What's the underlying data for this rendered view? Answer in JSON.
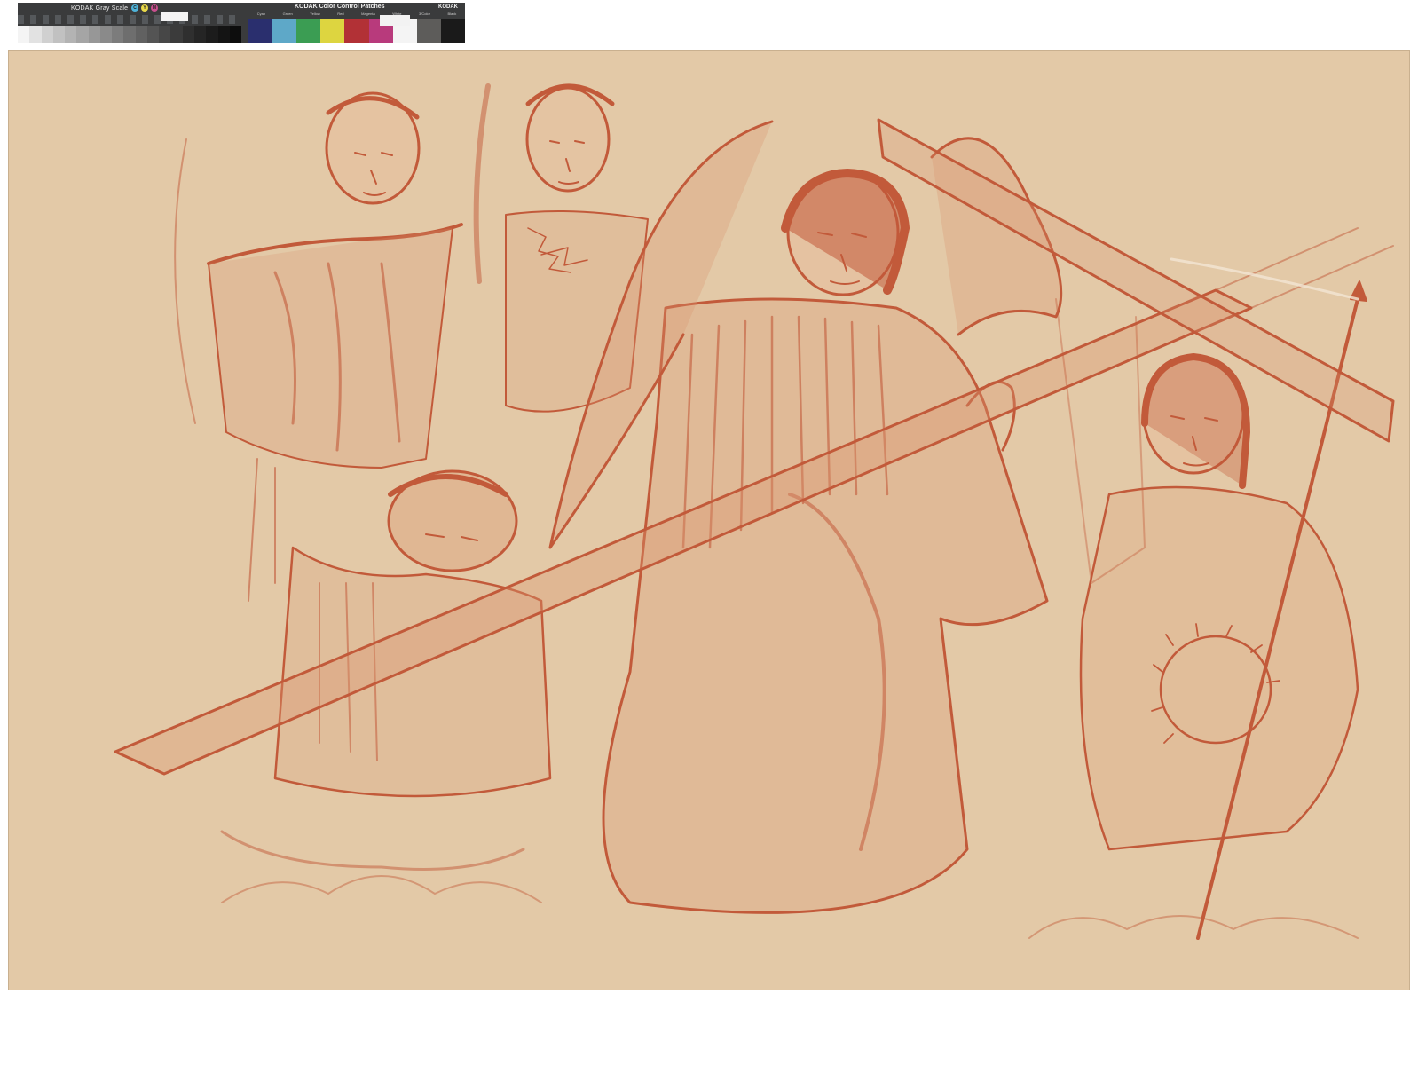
{
  "target": {
    "gray_scale_label": "KODAK Gray Scale",
    "cmy_letters": [
      "C",
      "Y",
      "M"
    ],
    "color_patches_label": "KODAK Color Control Patches",
    "color_patch_names": [
      "Cyan",
      "Green",
      "Yellow",
      "Red",
      "Magenta",
      "White",
      "3/Color",
      "Black"
    ],
    "logo": "KODAK",
    "gray_steps": [
      "#f4f4f4",
      "#e2e2e2",
      "#d0d0d0",
      "#c1c1c1",
      "#b3b3b3",
      "#a5a5a5",
      "#979797",
      "#8a8a8a",
      "#7c7c7c",
      "#6e6e6e",
      "#616161",
      "#545454",
      "#474747",
      "#3b3b3b",
      "#2f2f2f",
      "#252525",
      "#1c1c1c",
      "#141414",
      "#0d0d0d"
    ],
    "color_swatches": [
      "#2a2f6e",
      "#5ea8c8",
      "#3b9d53",
      "#ddd540",
      "#b23136",
      "#b83a7c",
      "#f4f4f4",
      "#5d5c5a",
      "#1a1a1a"
    ]
  },
  "artwork": {
    "paper_color": "#e3c9a7",
    "chalk_color": "#c25a3a",
    "description_icon": "red-chalk-drawing-of-angels-with-cross"
  }
}
